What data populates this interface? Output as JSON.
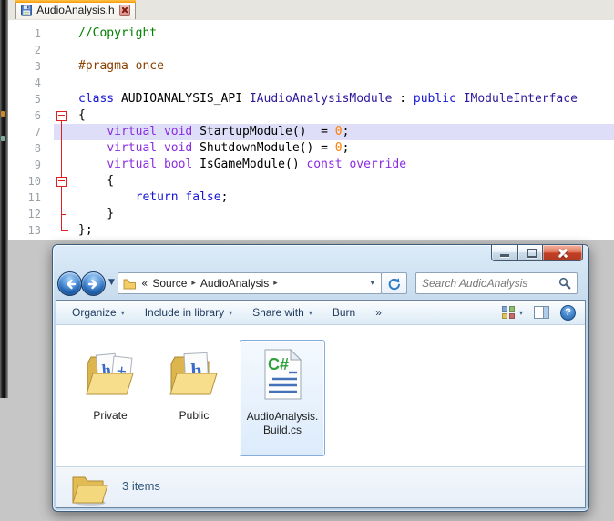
{
  "editor": {
    "tab_title": "AudioAnalysis.h",
    "icons": {
      "tab_file": "floppy-disk-icon",
      "tab_close": "close-icon",
      "fold_markers": "collapse-minus-boxes"
    },
    "colors": {
      "comment": "#008000",
      "preproc": "#8B4000",
      "kw_blue": "#1616D6",
      "kw_purple": "#8A2BE2",
      "type": "#30189C",
      "number": "#FF8000",
      "plain": "#000000",
      "line_number": "#98A0A8",
      "fold_red": "#E02020",
      "line_highlight": "#DEDEF8",
      "tab_accent": "#F59B00"
    },
    "lines": [
      {
        "n": 1,
        "tokens": [
          [
            "comment",
            "//Copyright"
          ]
        ]
      },
      {
        "n": 2,
        "tokens": []
      },
      {
        "n": 3,
        "tokens": [
          [
            "preproc",
            "#pragma once"
          ]
        ]
      },
      {
        "n": 4,
        "tokens": []
      },
      {
        "n": 5,
        "tokens": [
          [
            "kw_blue",
            "class"
          ],
          [
            "plain",
            " AUDIOANALYSIS_API "
          ],
          [
            "type",
            "IAudioAnalysisModule"
          ],
          [
            "plain",
            " : "
          ],
          [
            "kw_blue",
            "public"
          ],
          [
            "plain",
            " "
          ],
          [
            "type",
            "IModuleInterface"
          ]
        ]
      },
      {
        "n": 6,
        "fold": "box",
        "tokens": [
          [
            "plain",
            "{"
          ]
        ]
      },
      {
        "n": 7,
        "highlight": true,
        "tokens": [
          [
            "plain",
            "    "
          ],
          [
            "kw_purple",
            "virtual"
          ],
          [
            "plain",
            " "
          ],
          [
            "kw_purple",
            "void"
          ],
          [
            "plain",
            " StartupModule()  = "
          ],
          [
            "number",
            "0"
          ],
          [
            "plain",
            ";"
          ]
        ]
      },
      {
        "n": 8,
        "tokens": [
          [
            "plain",
            "    "
          ],
          [
            "kw_purple",
            "virtual"
          ],
          [
            "plain",
            " "
          ],
          [
            "kw_purple",
            "void"
          ],
          [
            "plain",
            " ShutdownModule() = "
          ],
          [
            "number",
            "0"
          ],
          [
            "plain",
            ";"
          ]
        ]
      },
      {
        "n": 9,
        "tokens": [
          [
            "plain",
            "    "
          ],
          [
            "kw_purple",
            "virtual"
          ],
          [
            "plain",
            " "
          ],
          [
            "kw_purple",
            "bool"
          ],
          [
            "plain",
            " IsGameModule() "
          ],
          [
            "kw_purple",
            "const"
          ],
          [
            "plain",
            " "
          ],
          [
            "kw_purple",
            "override"
          ]
        ]
      },
      {
        "n": 10,
        "fold": "box",
        "tokens": [
          [
            "plain",
            "    {"
          ]
        ]
      },
      {
        "n": 11,
        "tokens": [
          [
            "plain",
            "        "
          ],
          [
            "kw_blue",
            "return"
          ],
          [
            "plain",
            " "
          ],
          [
            "kw_blue",
            "false"
          ],
          [
            "plain",
            ";"
          ]
        ]
      },
      {
        "n": 12,
        "tokens": [
          [
            "plain",
            "    }"
          ]
        ]
      },
      {
        "n": 13,
        "tokens": [
          [
            "plain",
            "};"
          ]
        ]
      }
    ]
  },
  "explorer": {
    "window_buttons": [
      "minimize",
      "maximize",
      "close"
    ],
    "icons": {
      "back": "nav-back-circle-icon",
      "forward": "nav-forward-circle-icon",
      "address_folder": "folder-icon",
      "refresh": "refresh-icon",
      "search": "magnifier-icon",
      "views": "views-grid-icon",
      "preview": "preview-pane-icon",
      "help": "help-question-icon",
      "status": "open-folder-icon"
    },
    "address": {
      "overflow_chevron": "«",
      "crumbs": [
        "Source",
        "AudioAnalysis"
      ],
      "separator": "▸",
      "dropdown_glyph": "▾"
    },
    "search": {
      "placeholder": "Search AudioAnalysis"
    },
    "toolbar": {
      "dropdown_glyph": "▾",
      "items": [
        {
          "name": "organize",
          "label": "Organize",
          "dropdown": true
        },
        {
          "name": "include-in-library",
          "label": "Include in library",
          "dropdown": true
        },
        {
          "name": "share-with",
          "label": "Share with",
          "dropdown": true
        },
        {
          "name": "burn",
          "label": "Burn",
          "dropdown": false
        },
        {
          "name": "more",
          "label": "»",
          "dropdown": false
        }
      ]
    },
    "files": [
      {
        "name": "Private",
        "lines": [
          "Private"
        ],
        "icon": "folder-with-header-files",
        "icon_letters": [
          "h",
          "+"
        ],
        "selected": false
      },
      {
        "name": "Public",
        "lines": [
          "Public"
        ],
        "icon": "folder-with-header-file",
        "icon_letters": [
          "h"
        ],
        "selected": false
      },
      {
        "name": "AudioAnalysis.Build.cs",
        "lines": [
          "AudioAnalysis.",
          "Build.cs"
        ],
        "icon": "csharp-file",
        "icon_letters": [
          "C#"
        ],
        "selected": true
      }
    ],
    "status": {
      "text": "3 items"
    },
    "colors": {
      "aero_frame": "#BED5EA",
      "selection_border": "#84ACDD",
      "close_button_red": "#C33F26",
      "folder_yellow": "#EFCB6A",
      "csharp_green": "#2AA23C",
      "header_letter_blue": "#3A6CC8"
    }
  }
}
